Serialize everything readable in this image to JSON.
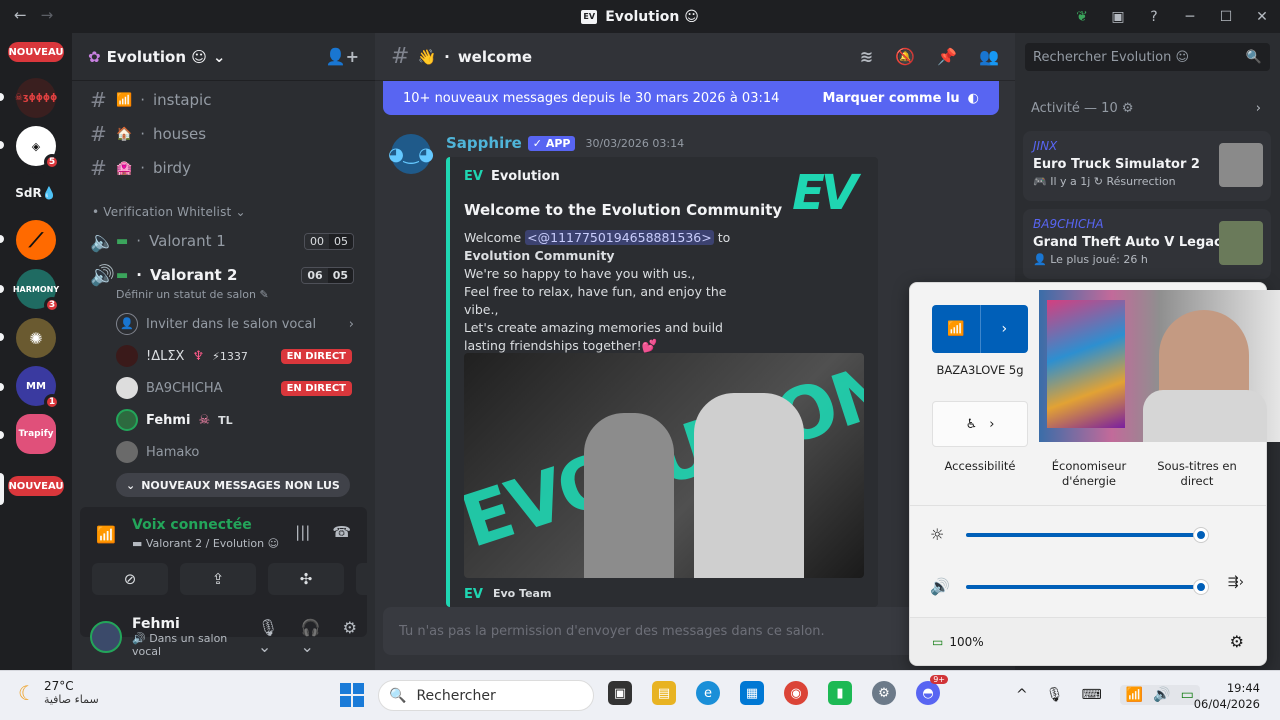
{
  "window": {
    "title": "Evolution ☺",
    "back": "←",
    "forward": "→",
    "min": "─",
    "max": "☐",
    "close": "✕"
  },
  "servers": {
    "nouveau_top": "NOUVEAU",
    "nouveau_bottom": "NOUVEAU",
    "badges": [
      "5",
      "3",
      "1"
    ],
    "label_sdr": "SdR"
  },
  "guild": {
    "name": "Evolution ☺"
  },
  "channels": [
    {
      "name": "instapic",
      "emoji": "📶"
    },
    {
      "name": "houses",
      "emoji": "🏠"
    },
    {
      "name": "birdy",
      "emoji": "🏩"
    }
  ],
  "category": "Verification Whitelist",
  "voice": [
    {
      "name": "Valorant 1",
      "count": "00",
      "limit": "05"
    },
    {
      "name": "Valorant 2",
      "count": "06",
      "limit": "05"
    }
  ],
  "set_status": "Définir un statut de salon",
  "invite_voice": "Inviter dans le salon vocal",
  "voice_users": [
    {
      "name": "!ΔLΣX",
      "tag": "⚡1337",
      "live": "EN DIRECT"
    },
    {
      "name": "BA9CHICHA",
      "tag": "",
      "live": "EN DIRECT"
    },
    {
      "name": "Fehmi",
      "tag": "TL",
      "live": ""
    },
    {
      "name": "Hamako",
      "tag": "",
      "live": ""
    }
  ],
  "new_unread": "NOUVEAUX MESSAGES NON LUS",
  "voice_panel": {
    "status": "Voix connectée",
    "sub": "Valorant 2 / Evolution ☺"
  },
  "user": {
    "name": "Fehmi",
    "status": "Dans un salon vocal"
  },
  "channel_header": {
    "name": "welcome",
    "emoji": "👋"
  },
  "new_bar": {
    "text": "10+ nouveaux messages depuis le 30 mars 2026 à 03:14",
    "mark": "Marquer comme lu"
  },
  "message": {
    "author": "Sapphire",
    "badge": "✓ APP",
    "time": "30/03/2026 03:14",
    "embed": {
      "author": "Evolution",
      "title": "Welcome to the Evolution Community",
      "welcome_pre": "Welcome ",
      "mention": "<@1117750194658881536>",
      "welcome_mid": " to ",
      "community": "Evolution Community",
      "lines": [
        "We're so happy to have you with us.,",
        "Feel free to relax, have fun, and enjoy the vibe.,",
        "Let's create amazing memories and build lasting friendships together!💕"
      ],
      "thumb": "EV",
      "image_text": "EVOLUTION",
      "footer": "Evo Team"
    }
  },
  "composer": "Tu n'as pas la permission d'envoyer des messages dans ce salon.",
  "right": {
    "search": "Rechercher Evolution ☺",
    "activity": "Activité — 10",
    "cards": [
      {
        "who": "JINX",
        "game": "Euro Truck Simulator 2",
        "meta": "Il y a 1j  ↻ Résurrection"
      },
      {
        "who": "BA9CHICHA",
        "game": "Grand Theft Auto V Legacy",
        "meta": "Le plus joué: 26 h"
      }
    ]
  },
  "quick_settings": {
    "wifi": "BAZA3LOVE 5g",
    "accessibility": "Accessibilité",
    "energy": "Économiseur d'énergie",
    "captions": "Sous-titres en direct",
    "battery": "100%",
    "brightness_level": 1.0,
    "volume_level": 1.0
  },
  "taskbar": {
    "temp": "27°C",
    "weather": "سماء صافية",
    "search": "Rechercher",
    "discord_badge": "9+",
    "time": "19:44",
    "date": "06/04/2026"
  }
}
